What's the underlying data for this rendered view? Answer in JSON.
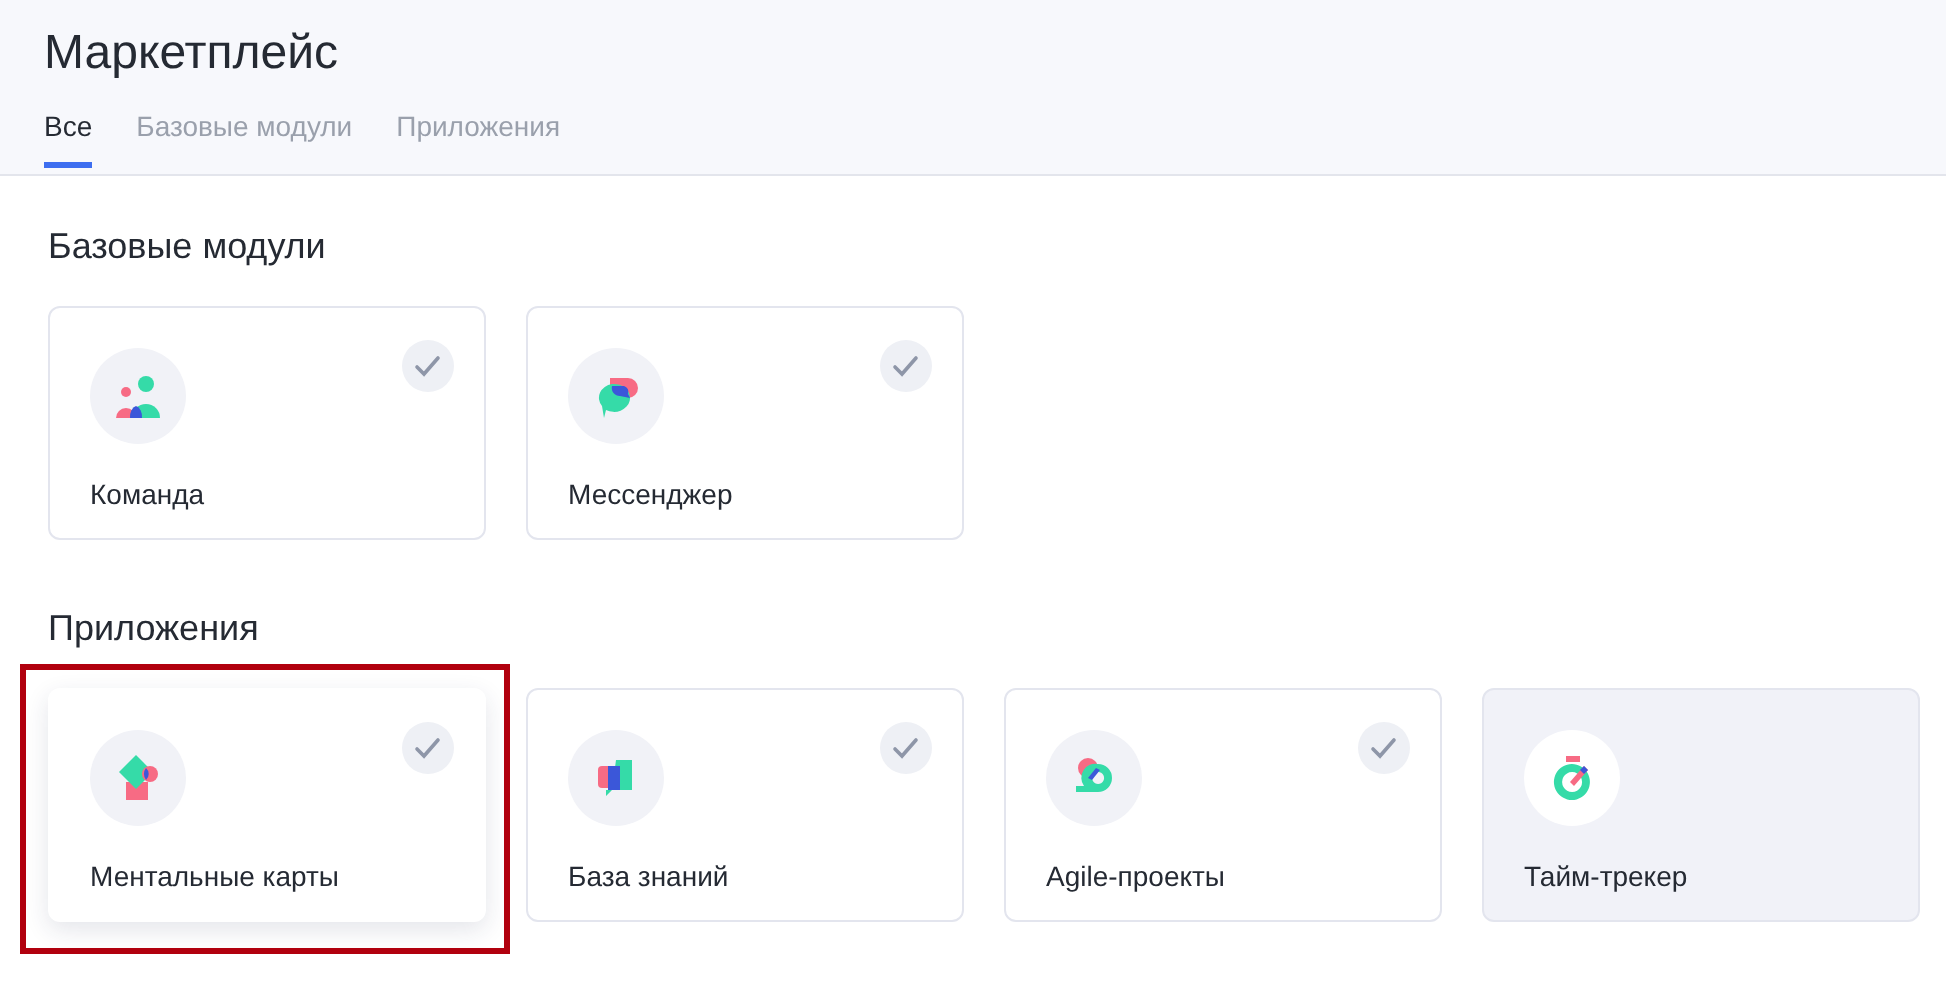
{
  "header": {
    "title": "Маркетплейс"
  },
  "tabs": [
    {
      "label": "Все",
      "selected": true
    },
    {
      "label": "Базовые модули",
      "selected": false
    },
    {
      "label": "Приложения",
      "selected": false
    }
  ],
  "sections": [
    {
      "title": "Базовые модули",
      "cards": [
        {
          "name": "Команда",
          "installed": true,
          "highlighted": false
        },
        {
          "name": "Мессенджер",
          "installed": true,
          "highlighted": false
        }
      ]
    },
    {
      "title": "Приложения",
      "cards": [
        {
          "name": "Ментальные карты",
          "installed": true,
          "highlighted": true
        },
        {
          "name": "База знаний",
          "installed": true,
          "highlighted": false
        },
        {
          "name": "Agile-проекты",
          "installed": true,
          "highlighted": false
        },
        {
          "name": "Тайм-трекер",
          "installed": false,
          "highlighted": false
        }
      ]
    }
  ]
}
